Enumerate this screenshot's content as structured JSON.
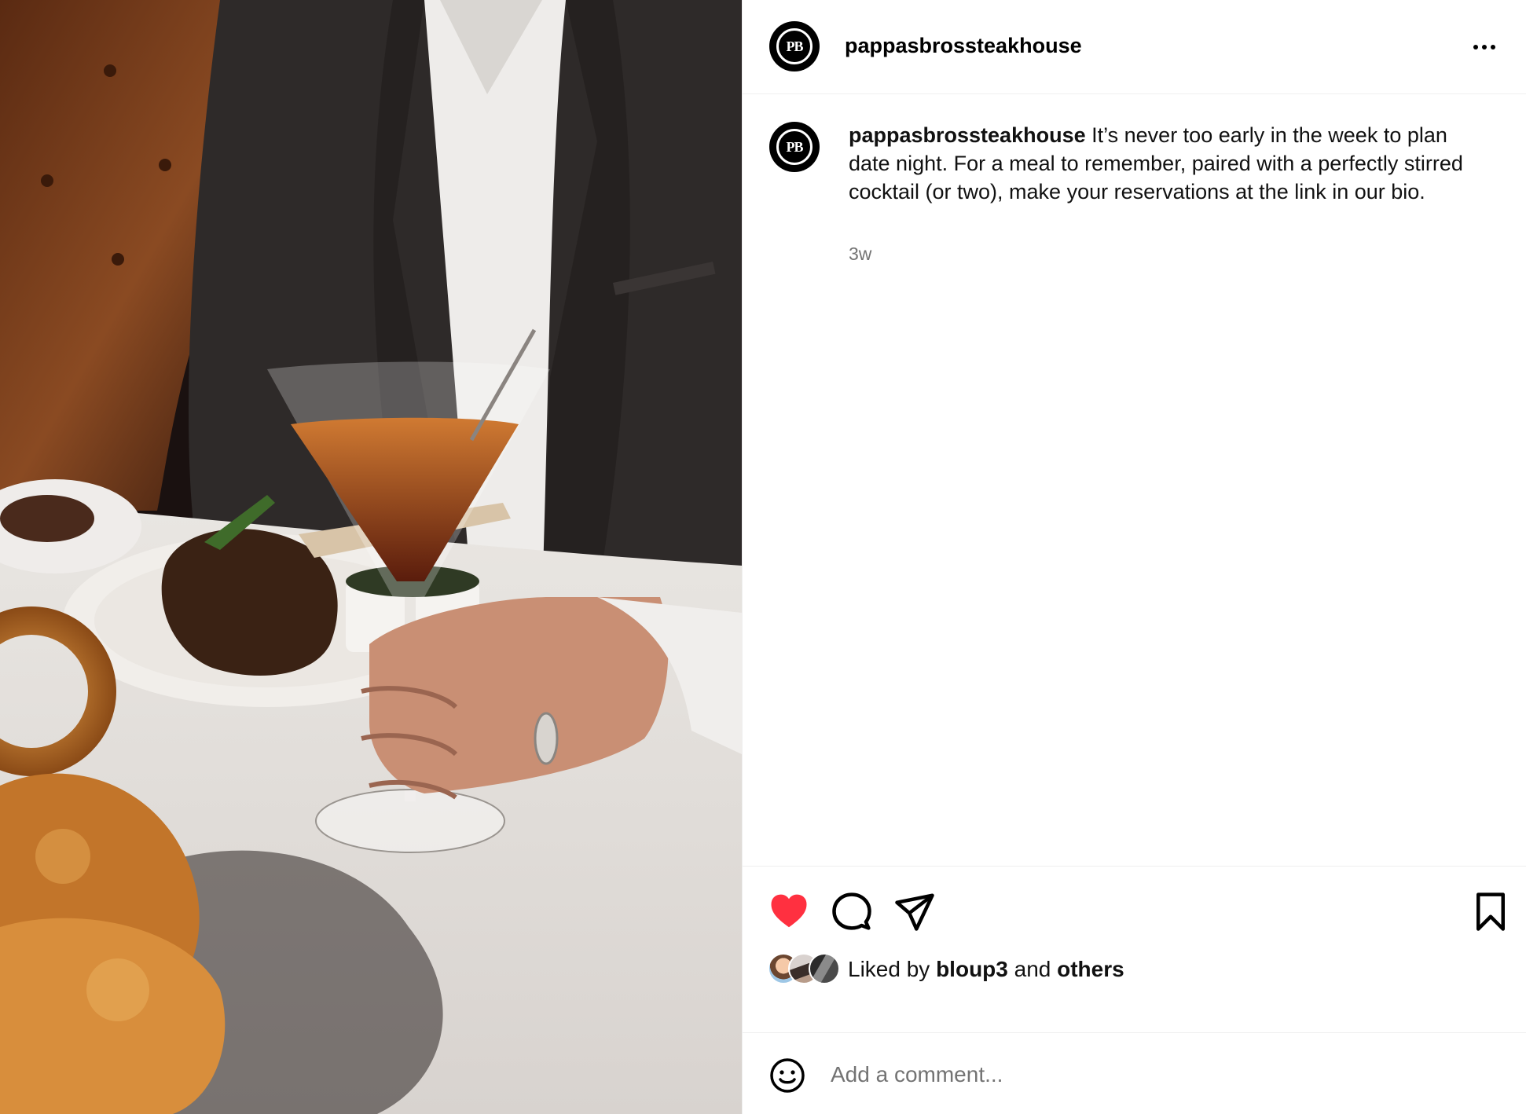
{
  "post": {
    "username": "pappasbrossteakhouse",
    "avatar_initials": "PB",
    "caption_username": "pappasbrossteakhouse",
    "caption_text": "It’s never too early in the week to plan date night. For a meal to remember, paired with a perfectly stirred cocktail (or two), make your reservations at the link in our bio.",
    "time_ago": "3w",
    "image_icon": "photo-steak-and-cocktail"
  },
  "actions": {
    "like_icon": "heart-filled-icon",
    "comment_icon": "comment-bubble-icon",
    "share_icon": "paper-plane-icon",
    "save_icon": "bookmark-icon",
    "liked_color": "#ff3040"
  },
  "likes": {
    "prefix": "Liked by ",
    "user": "bloup3",
    "connector": " and ",
    "others": "others"
  },
  "comment_box": {
    "emoji_icon": "smiley-icon",
    "placeholder": "Add a comment..."
  }
}
